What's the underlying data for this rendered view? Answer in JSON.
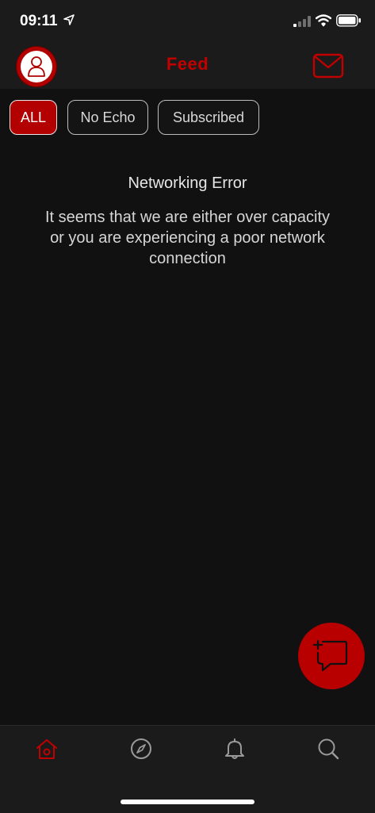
{
  "status_bar": {
    "time": "09:11"
  },
  "header": {
    "title": "Feed",
    "accent_color": "#c10000"
  },
  "filters": {
    "items": [
      {
        "label": "ALL",
        "active": true
      },
      {
        "label": "No Echo",
        "active": false
      },
      {
        "label": "Subscribed",
        "active": false
      }
    ]
  },
  "error": {
    "title": "Networking Error",
    "message": "It seems that we are either over capacity or you are experiencing a poor network connection"
  },
  "icons": {
    "fab": "new-post-icon",
    "tabs": [
      "home-icon",
      "explore-compass-icon",
      "notifications-bell-icon",
      "search-icon"
    ]
  }
}
